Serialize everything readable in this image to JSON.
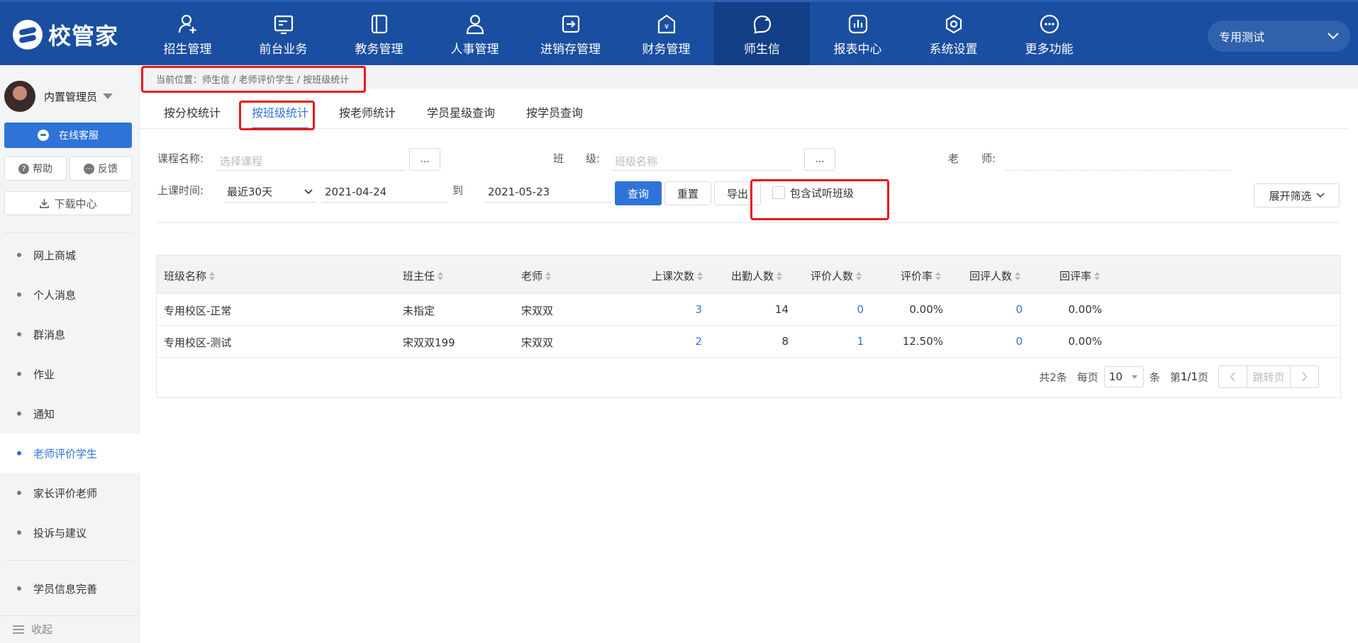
{
  "brand": {
    "name": "校管家"
  },
  "nav": [
    {
      "label": "招生管理",
      "icon": "user-plus-icon"
    },
    {
      "label": "前台业务",
      "icon": "card-icon"
    },
    {
      "label": "教务管理",
      "icon": "book-icon"
    },
    {
      "label": "人事管理",
      "icon": "person-icon"
    },
    {
      "label": "进销存管理",
      "icon": "box-arrow-icon"
    },
    {
      "label": "财务管理",
      "icon": "yen-house-icon"
    },
    {
      "label": "师生信",
      "icon": "chat-bubble-icon",
      "active": true
    },
    {
      "label": "报表中心",
      "icon": "bar-chart-icon"
    },
    {
      "label": "系统设置",
      "icon": "hexagon-gear-icon"
    },
    {
      "label": "更多功能",
      "icon": "more-dots-icon"
    }
  ],
  "campus": {
    "selected": "专用测试"
  },
  "sidebar": {
    "user_name": "内置管理员",
    "online_service": "在线客服",
    "help": "帮助",
    "feedback": "反馈",
    "download": "下载中心",
    "items": [
      {
        "label": "网上商城"
      },
      {
        "label": "个人消息"
      },
      {
        "label": "群消息"
      },
      {
        "label": "作业"
      },
      {
        "label": "通知"
      },
      {
        "label": "老师评价学生",
        "active": true
      },
      {
        "label": "家长评价老师"
      },
      {
        "label": "投诉与建议"
      },
      {
        "label": "学员信息完善"
      }
    ],
    "collapse": "收起"
  },
  "breadcrumb": "当前位置：师生信 / 老师评价学生 / 按班级统计",
  "tabs": [
    {
      "label": "按分校统计"
    },
    {
      "label": "按班级统计",
      "active": true
    },
    {
      "label": "按老师统计"
    },
    {
      "label": "学员星级查询"
    },
    {
      "label": "按学员查询"
    }
  ],
  "filters": {
    "course_label": "课程名称:",
    "course_placeholder": "选择课程",
    "class_label_1": "班",
    "class_label_2": "级:",
    "class_placeholder": "班级名称",
    "teacher_label_1": "老",
    "teacher_label_2": "师:",
    "time_label": "上课时间:",
    "time_range": "最近30天",
    "date_from": "2021-04-24",
    "to": "到",
    "date_to": "2021-05-23",
    "query": "查询",
    "reset": "重置",
    "export": "导出",
    "include_trial": "包含试听班级",
    "expand": "展开筛选",
    "dots": "..."
  },
  "table": {
    "columns": [
      "班级名称",
      "班主任",
      "老师",
      "上课次数",
      "出勤人数",
      "评价人数",
      "评价率",
      "回评人数",
      "回评率"
    ],
    "rows": [
      {
        "class": "专用校区-正常",
        "head": "未指定",
        "teacher": "宋双双",
        "lessons": "3",
        "attend": "14",
        "eval": "0",
        "eval_rate": "0.00%",
        "reply": "0",
        "reply_rate": "0.00%"
      },
      {
        "class": "专用校区-测试",
        "head": "宋双双199",
        "teacher": "宋双双",
        "lessons": "2",
        "attend": "8",
        "eval": "1",
        "eval_rate": "12.50%",
        "reply": "0",
        "reply_rate": "0.00%"
      }
    ]
  },
  "pager": {
    "total": "共2条",
    "per_page": "每页",
    "size": "10",
    "unit": "条",
    "page_pre": "第",
    "page_info": "1/1",
    "page_post": "页",
    "jump": "跳转页"
  },
  "colors": {
    "nav_bg": "#1a4ea0",
    "accent": "#2f73d8",
    "highlight": "#e81919"
  }
}
